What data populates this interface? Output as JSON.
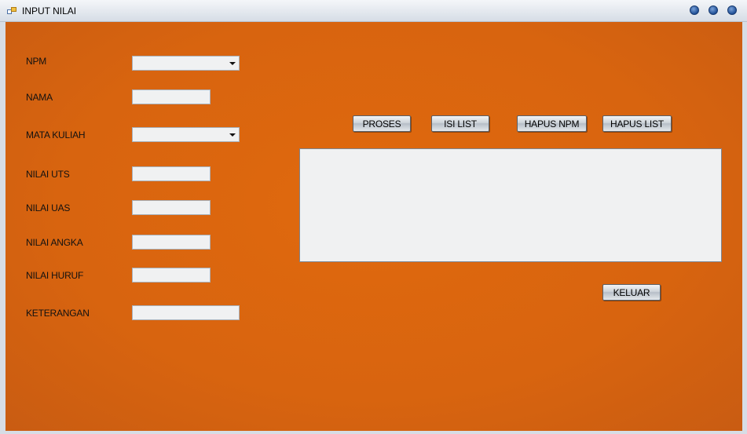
{
  "window": {
    "title": "INPUT NILAI"
  },
  "form": {
    "npm_label": "NPM",
    "nama_label": "NAMA",
    "mata_kuliah_label": "MATA KULIAH",
    "nilai_uts_label": "NILAI UTS",
    "nilai_uas_label": "NILAI UAS",
    "nilai_angka_label": "NILAI ANGKA",
    "nilai_huruf_label": "NILAI HURUF",
    "keterangan_label": "KETERANGAN"
  },
  "buttons": {
    "proses": "PROSES",
    "isi_list": "ISI LIST",
    "hapus_npm": "HAPUS NPM",
    "hapus_list": "HAPUS LIST",
    "keluar": "KELUAR"
  },
  "colors": {
    "background": "#d8640f",
    "field": "#f0f1f2",
    "title_buttons": "#2a5aa0"
  },
  "icons": [
    "app-icon",
    "dropdown-arrow-icon"
  ]
}
